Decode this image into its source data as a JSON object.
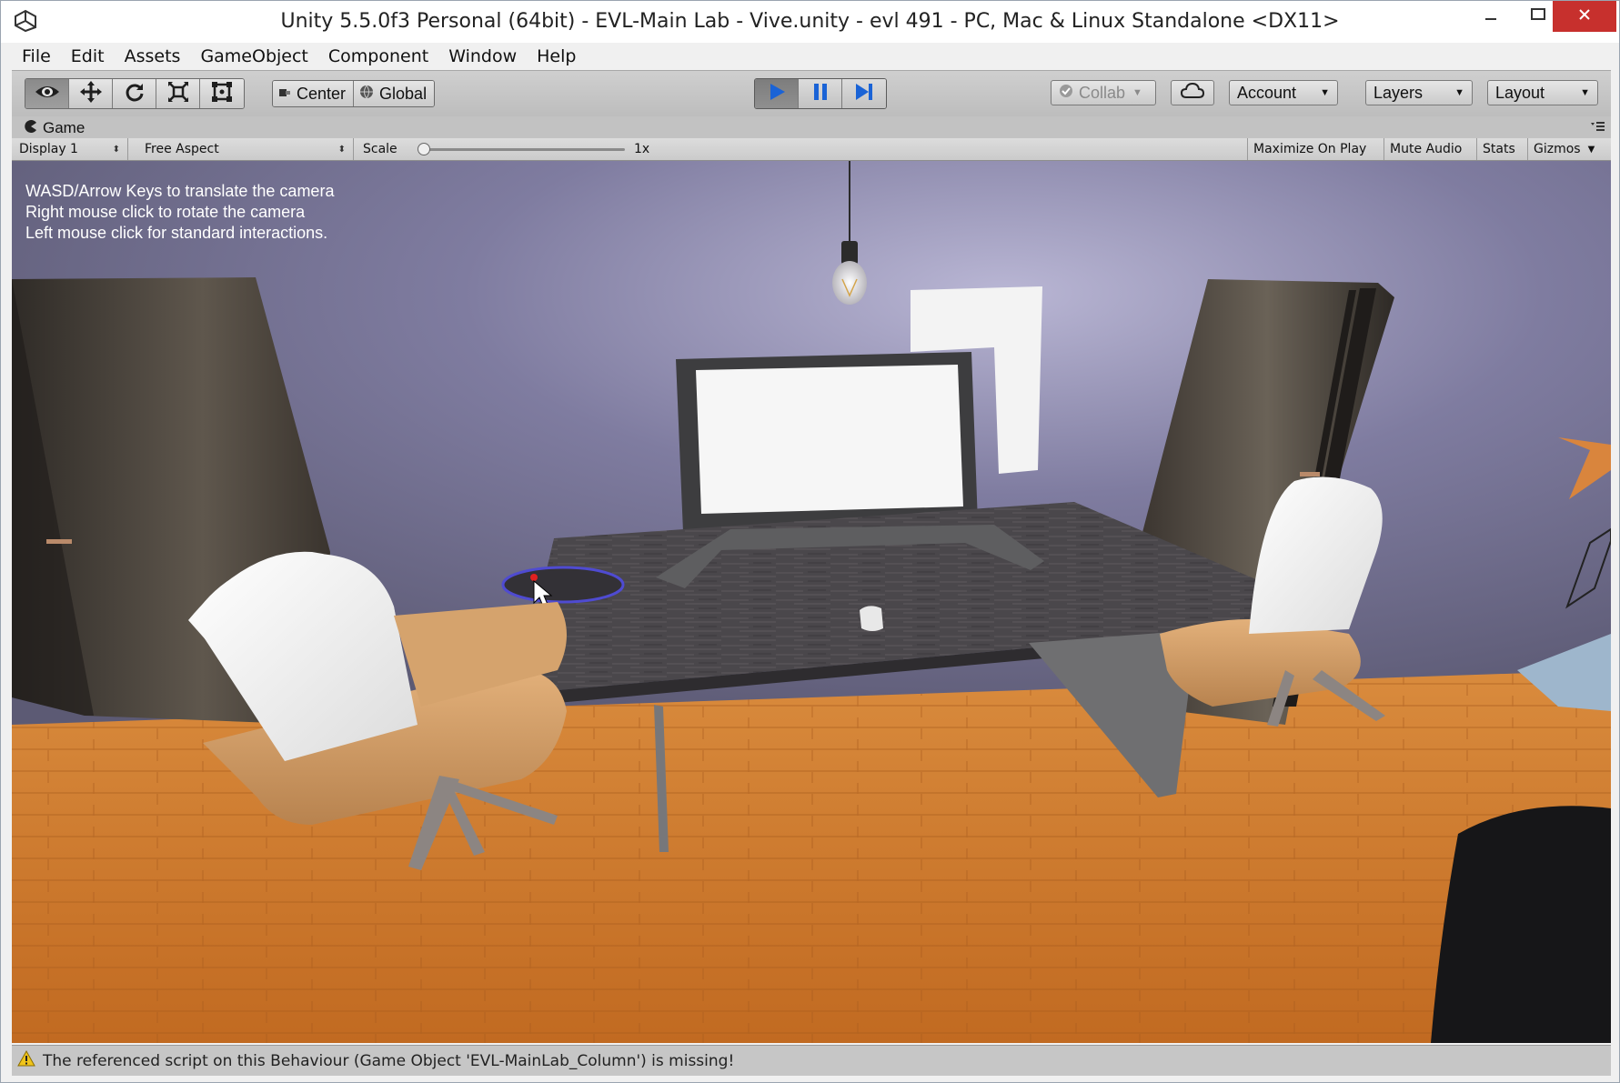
{
  "window": {
    "title": "Unity 5.5.0f3 Personal (64bit) - EVL-Main Lab - Vive.unity - evl 491 - PC, Mac & Linux Standalone <DX11>",
    "app_icon": "unity-logo-icon",
    "controls": [
      "minimize-icon",
      "maximize-icon",
      "close-icon"
    ]
  },
  "menubar": {
    "items": [
      "File",
      "Edit",
      "Assets",
      "GameObject",
      "Component",
      "Window",
      "Help"
    ]
  },
  "toolbar": {
    "transform_tools": [
      "view-eye-icon",
      "move-arrows-icon",
      "rotate-icon",
      "scale-icon",
      "rect-transform-icon"
    ],
    "active_tool": "view-eye-icon",
    "pivot_mode": "Center",
    "pivot_rotation": "Global",
    "play_controls": [
      "play-icon",
      "pause-icon",
      "step-icon"
    ],
    "playing": true,
    "collab": "Collab",
    "cloud_icon": "cloud-icon",
    "account": "Account",
    "layers": "Layers",
    "layout": "Layout",
    "accent_color": "#1a63d6"
  },
  "game_view": {
    "tab_label": "Game",
    "display": "Display 1",
    "aspect": "Free Aspect",
    "scale_label": "Scale",
    "scale_value": "1x",
    "toggles": [
      "Maximize On Play",
      "Mute Audio",
      "Stats",
      "Gizmos"
    ],
    "help_lines": [
      "WASD/Arrow Keys to translate the camera",
      "Right mouse click to rotate the camera",
      "Left mouse click for standard interactions."
    ]
  },
  "status": {
    "icon": "warning-icon",
    "message": "The referenced script on this Behaviour (Game Object 'EVL-MainLab_Column') is missing!"
  },
  "colors": {
    "wall": "#6f6d8f",
    "floor": "#c8782f",
    "table_top": "#4a474b",
    "chair_seat": "#f3f3f3",
    "chair_shell": "#cf9a62"
  }
}
